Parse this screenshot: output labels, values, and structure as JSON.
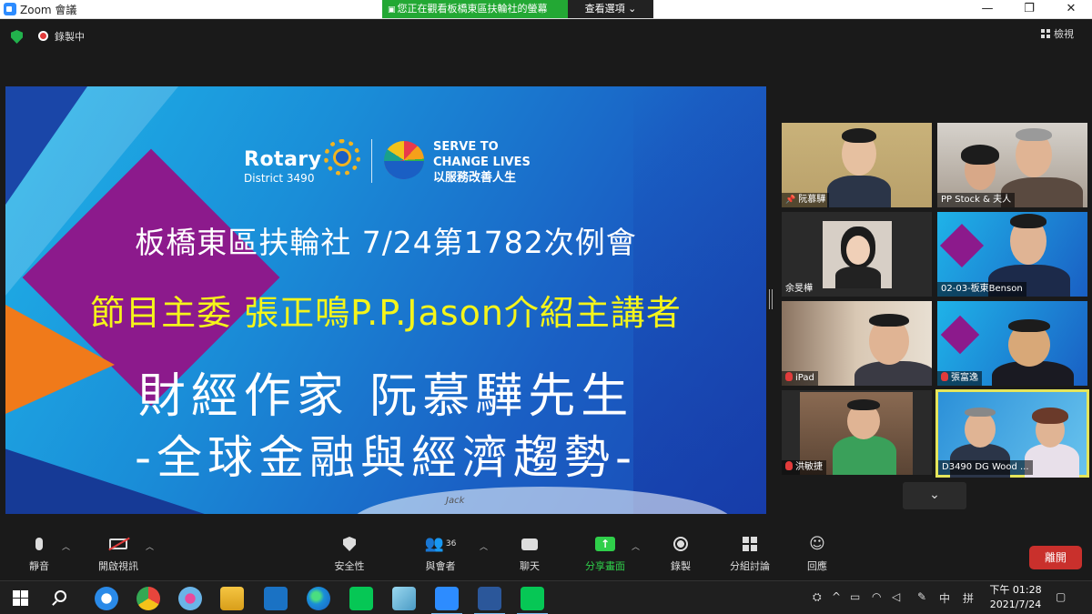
{
  "window": {
    "title": "Zoom 會議",
    "minimize": "—",
    "maximize": "❐",
    "close": "✕"
  },
  "share_banner": {
    "text": "您正在觀看板橋東區扶輪社的螢幕",
    "view_options": "查看選項 ⌄"
  },
  "status": {
    "recording": "錄製中",
    "view_label": "檢視"
  },
  "slide": {
    "rotary_name": "Rotary",
    "district": "District 3490",
    "serve_line1": "SERVE TO",
    "serve_line2": "CHANGE LIVES",
    "serve_line3": "以服務改善人生",
    "line1": "板橋東區扶輪社  7/24第1782次例會",
    "line2": "節目主委 張正鳴P.P.Jason介紹主講者",
    "line3": "財經作家  阮慕驊先生",
    "line4": "-全球金融與經濟趨勢-",
    "signature": "Jack"
  },
  "participants": [
    {
      "name": "阮慕驊",
      "pinned": true,
      "muted": false
    },
    {
      "name": "PP Stock & 夫人",
      "muted": false
    },
    {
      "name": "余旻樺",
      "muted": false
    },
    {
      "name": "02-03-板東Benson",
      "muted": false
    },
    {
      "name": "iPad",
      "muted": true
    },
    {
      "name": "張富逸",
      "muted": true
    },
    {
      "name": "洪敏捷",
      "muted": true
    },
    {
      "name": "D3490 DG  Wood ...",
      "muted": false,
      "active_speaker": true
    }
  ],
  "toolbar": {
    "mute": "靜音",
    "video": "開啟視訊",
    "security": "安全性",
    "participants": "與會者",
    "participants_count": "36",
    "chat": "聊天",
    "share": "分享畫面",
    "record": "錄製",
    "breakout": "分組討論",
    "reactions": "回應",
    "leave": "離開"
  },
  "taskbar": {
    "time": "下午 01:28",
    "date": "2021/7/24",
    "ime": "中",
    "ime2": "拼"
  },
  "colors": {
    "zoom_blue": "#2D8CFF",
    "share_green": "#23a834",
    "leave_red": "#c9302c",
    "slide_yellow": "#f5f51a"
  }
}
